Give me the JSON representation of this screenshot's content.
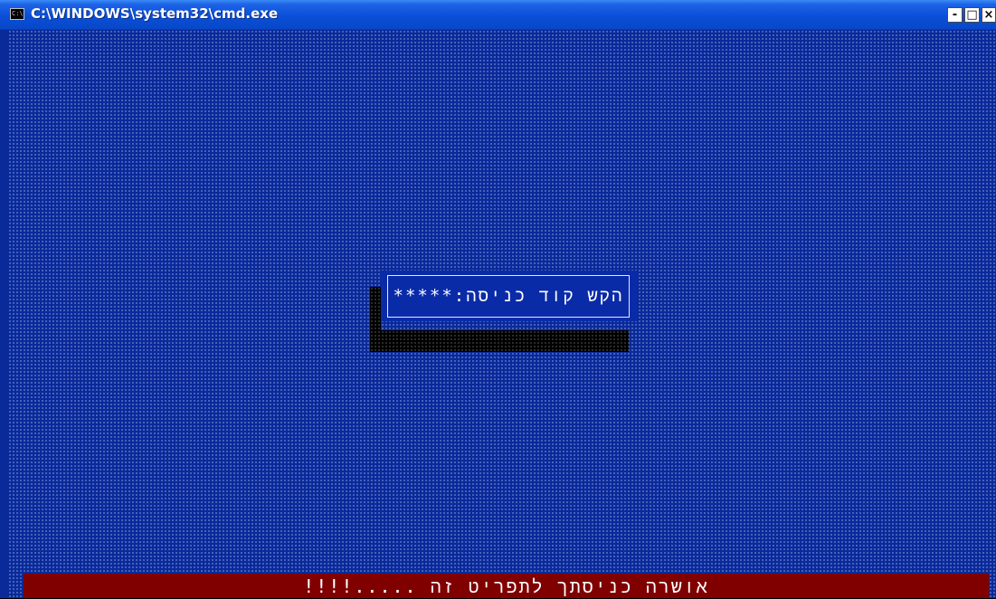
{
  "window": {
    "title": "C:\\WINDOWS\\system32\\cmd.exe",
    "icon": "console-icon",
    "icon_text": "C:\\",
    "buttons": {
      "minimize": "-",
      "maximize": "□",
      "close": "×"
    }
  },
  "console": {
    "background_color": "#0a2a9a",
    "dialog": {
      "prompt": "הקש קוד כניסה:*****"
    },
    "status_bar": {
      "color": "#800000",
      "message": "אושרה כניסתך לתפריט זה .....!!!!"
    }
  }
}
